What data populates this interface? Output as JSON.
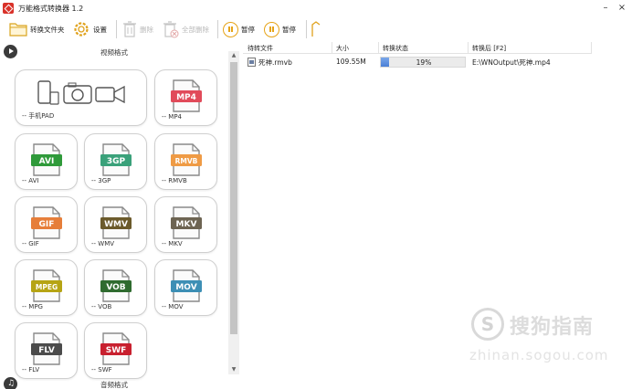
{
  "window": {
    "title": "万能格式转换器 1.2",
    "minimize_label": "–",
    "close_label": "×"
  },
  "toolbar": {
    "convert_folder": "转换文件夹",
    "settings": "设置",
    "delete": "删除",
    "delete_all": "全部删除",
    "pause": "暂停",
    "stop": "暂停"
  },
  "video_section": {
    "title": "视频格式",
    "items": [
      {
        "caption": "-- 手机PAD",
        "badge": ""
      },
      {
        "caption": "-- MP4",
        "badge": "MP4",
        "color": "#e14b5a"
      },
      {
        "caption": "-- AVI",
        "badge": "AVI",
        "color": "#2f9a3a"
      },
      {
        "caption": "-- 3GP",
        "badge": "3GP",
        "color": "#3aa17a"
      },
      {
        "caption": "-- RMVB",
        "badge": "RMVB",
        "color": "#ef9b45"
      },
      {
        "caption": "-- GIF",
        "badge": "GIF",
        "color": "#e67e3a"
      },
      {
        "caption": "-- WMV",
        "badge": "WMV",
        "color": "#6b5a2b"
      },
      {
        "caption": "-- MKV",
        "badge": "MKV",
        "color": "#6d6452"
      },
      {
        "caption": "-- MPG",
        "badge": "MPEG",
        "color": "#b6a414"
      },
      {
        "caption": "-- VOB",
        "badge": "VOB",
        "color": "#2f6b2f"
      },
      {
        "caption": "-- MOV",
        "badge": "MOV",
        "color": "#3d8fb5"
      },
      {
        "caption": "-- FLV",
        "badge": "FLV",
        "color": "#4b4b4b"
      },
      {
        "caption": "-- SWF",
        "badge": "SWF",
        "color": "#c8202f"
      }
    ]
  },
  "audio_section": {
    "title": "音频格式"
  },
  "file_list": {
    "columns": [
      "待转文件",
      "大小",
      "转换状态",
      "转换后 [F2]"
    ],
    "rows": [
      {
        "name": "死神.rmvb",
        "size": "109.55M",
        "progress": 19,
        "progress_text": "19%",
        "output": "E:\\WNOutput\\死神.mp4"
      }
    ]
  },
  "watermark": {
    "letter": "S",
    "name": "搜狗指南",
    "url": "zhinan.sogou.com"
  },
  "colors": {
    "accent_red": "#d9322a",
    "pause_orange": "#e6a317",
    "progress_blue": "#4a7fd6"
  }
}
